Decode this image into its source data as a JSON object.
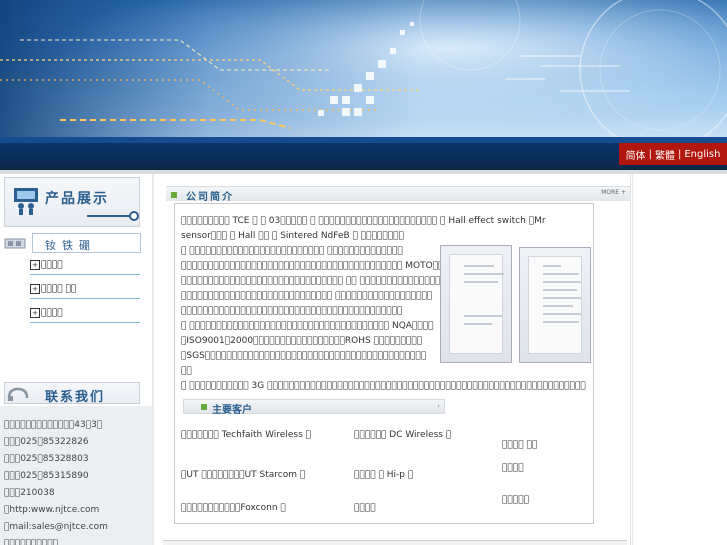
{
  "header": {
    "languages": [
      "简体",
      "繁體",
      "English"
    ],
    "lang_separator": "|"
  },
  "sidebar": {
    "products_title": "产品展示",
    "category_title": "钕铁硼",
    "categories": [
      {
        "label": "\u0000\u0000\u0000\u0000"
      },
      {
        "label": "\u0000\u0000\u0000\u0000 \u0000\u0000"
      },
      {
        "label": "\u0000\u0000\u0000\u0000"
      }
    ],
    "contact_title": "联系我们",
    "contact_lines": [
      "\u0000\u0000\u0000\u0000\u0000\u0000\u0000\u0000\u0000\u0000\u0000\u0000\u000043\u00003\u0000",
      "\u0000\u0000\u0000025\u000085322826",
      "\u0000\u0000\u0000025\u000085328803",
      "\u0000\u0000\u0000025\u000085315890",
      "\u0000\u0000\u0000210038",
      "\u0000http:www.njtce.com",
      "\u0000mail:sales@njtce.com",
      "\u0000\u0000\u0000\u0000\u0000\u0000\u0000\u0000\u0000\u0000"
    ]
  },
  "intro": {
    "title": "公司简介",
    "more": "MORE +",
    "lines": [
      "\u0000\u0000\u0000\u0000\u0000\u0000\u0000\u0000\u0000 TCE \u0000 \u0000 03\u0000\u0000\u0000\u0000\u0000 \u0000 \u0000\u0000\u0000\u0000\u0000\u0000\u0000\u0000\u0000\u0000\u0000\u0000\u0000\u0000\u0000\u0000\u0000\u0000\u0000\u0000\u0000\u0000 \u0000 Hall effect switch \u0000Mr",
      "sensor\u0000\u0000\u0000 \u0000 Hall \u0000\u0000 \u0000 Sintered NdFeB \u0000 \u0000\u0000\u0000\u0000\u0000\u0000\u0000\u0000",
      "\u0000 \u0000\u0000\u0000\u0000\u0000\u0000\u0000\u0000\u0000\u0000\u0000\u0000\u0000\u0000\u0000\u0000\u0000\u0000\u0000\u0000\u0000\u0000\u0000\u0000\u0000 \u0000\u0000\u0000\u0000\u0000\u0000\u0000\u0000\u0000\u0000\u0000\u0000\u0000\u0000",
      "\u0000\u0000\u0000\u0000\u0000\u0000\u0000\u0000\u0000\u0000\u0000\u0000\u0000\u0000\u0000\u0000\u0000\u0000\u0000\u0000\u0000\u0000\u0000\u0000\u0000\u0000\u0000\u0000\u0000\u0000\u0000\u0000\u0000\u0000\u0000\u0000\u0000\u0000\u0000\u0000\u0000 MOTO\u0000\u0000",
      "\u0000\u0000\u0000\u0000\u0000\u0000\u0000\u0000\u0000\u0000\u0000\u0000\u0000\u0000\u0000\u0000\u0000\u0000\u0000\u0000\u0000\u0000\u0000\u0000\u0000\u0000\u0000\u0000\u0000\u0000 \u0000\u0000 \u0000\u0000\u0000\u0000\u0000\u0000\u0000\u0000\u0000\u0000\u0000\u0000\u0000\u0000\u0000\u0000\u0000",
      "\u0000\u0000\u0000\u0000\u0000\u0000\u0000\u0000\u0000\u0000\u0000\u0000\u0000\u0000\u0000\u0000\u0000\u0000\u0000\u0000\u0000\u0000\u0000\u0000\u0000\u0000\u0000\u0000 \u0000\u0000\u0000\u0000\u0000\u0000\u0000\u0000\u0000\u0000\u0000\u0000\u0000\u0000\u0000\u0000\u0000\u0000",
      "\u0000\u0000\u0000\u0000\u0000\u0000\u0000\u0000\u0000\u0000\u0000\u0000\u0000\u0000\u0000\u0000\u0000\u0000\u0000\u0000\u0000\u0000\u0000\u0000\u0000\u0000\u0000\u0000\u0000\u0000\u0000\u0000\u0000\u0000\u0000\u0000\u0000\u0000\u0000\u0000\u0000",
      "\u0000 \u0000\u0000\u0000\u0000\u0000\u0000\u0000\u0000\u0000\u0000\u0000\u0000\u0000\u0000\u0000\u0000\u0000\u0000\u0000\u0000\u0000\u0000\u0000\u0000\u0000\u0000\u0000\u0000\u0000\u0000\u0000\u0000\u0000\u0000\u0000\u0000\u0000 NQA\u0000\u0000\u0000\u0000",
      "\u0000ISO9001\u00002000\u0000\u0000\u0000\u0000\u0000\u0000\u0000\u0000\u0000\u0000\u0000\u0000\u0000\u0000\u0000\u0000\u0000ROHS \u0000\u0000\u0000\u0000\u0000\u0000\u0000\u0000\u0000",
      "\u0000SGS\u0000\u0000\u0000\u0000\u0000\u0000\u0000\u0000\u0000\u0000\u0000\u0000\u0000\u0000\u0000\u0000\u0000\u0000\u0000\u0000\u0000\u0000\u0000\u0000\u0000\u0000\u0000\u0000\u0000\u0000\u0000\u0000\u0000\u0000\u0000\u0000\u0000\u0000\u0000\u0000\u0000",
      "\u0000\u0000",
      "\u0000 \u0000\u0000\u0000\u0000\u0000\u0000\u0000\u0000\u0000\u0000\u0000 3G \u0000\u0000\u0000\u0000\u0000\u0000\u0000\u0000\u0000\u0000\u0000\u0000\u0000\u0000\u0000\u0000\u0000\u0000\u0000\u0000\u0000\u0000\u0000\u0000\u0000\u0000\u0000\u0000\u0000\u0000\u0000\u0000\u0000\u0000\u0000\u0000\u0000\u0000\u0000\u0000\u0000\u0000\u0000\u0000\u0000\u0000\u0000\u0000\u0000\u0000\u0000\u0000\u0000\u0000\u0000\u0000\u0000\u0000\u0000"
    ]
  },
  "clients": {
    "title": "主要客户",
    "arrow": "›",
    "items": [
      "\u0000\u0000\u0000\u0000\u0000\u0000\u0000 Techfaith Wireless \u0000",
      "\u0000\u0000\u0000\u0000\u0000\u0000 DC Wireless \u0000",
      "\u0000\u0000\u0000\u0000 \u0000\u0000",
      "\u0000UT \u0000\u0000\u0000\u0000\u0000\u0000\u0000\u0000UT Starcom \u0000",
      "\u0000\u0000\u0000\u0000 \u0000 Hi-p \u0000",
      "\u0000\u0000\u0000\u0000",
      "\u0000\u0000\u0000\u0000\u0000\u0000\u0000\u0000\u0000\u0000\u0000Foxconn \u0000",
      "\u0000\u0000\u0000\u0000",
      "\u0000\u0000\u0000\u0000\u0000"
    ]
  },
  "colors": {
    "lang_bar": "#b1160f",
    "title_blue": "#2b5f8f",
    "accent_green": "#6aaa3a"
  }
}
